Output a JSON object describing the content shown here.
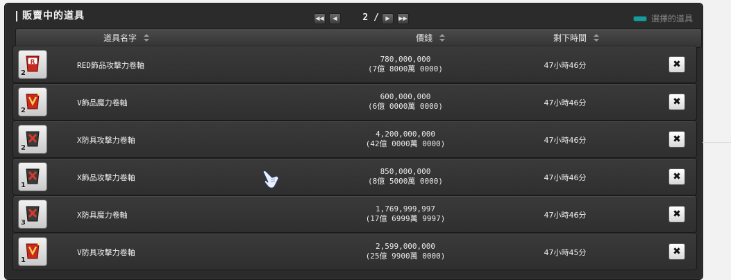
{
  "panel": {
    "title": "販賣中的道具"
  },
  "pager": {
    "first": "◀◀",
    "prev": "◀",
    "page": "2 / 5",
    "next": "▶",
    "last": "▶▶"
  },
  "legend": {
    "label": "選擇的道具",
    "swatch_color": "#1a9a9a"
  },
  "columns": {
    "name": "道具名字",
    "price": "價錢",
    "time": "剩下時間"
  },
  "delete_glyph": "✖",
  "rows": [
    {
      "icon": "red-scroll-r-icon",
      "qty": "2",
      "name": "RED飾品攻擊力卷軸",
      "price": "780,000,000",
      "price_detail": "(7億 8000萬 0000)",
      "time": "47小時46分"
    },
    {
      "icon": "v-scroll-red-icon",
      "qty": "2",
      "name": "V飾品魔力卷軸",
      "price": "600,000,000",
      "price_detail": "(6億 0000萬 0000)",
      "time": "47小時46分"
    },
    {
      "icon": "x-scroll-dark-icon",
      "qty": "2",
      "name": "X防具攻擊力卷軸",
      "price": "4,200,000,000",
      "price_detail": "(42億 0000萬 0000)",
      "time": "47小時46分"
    },
    {
      "icon": "x-scroll-dark-icon",
      "qty": "1",
      "name": "X飾品攻擊力卷軸",
      "price": "850,000,000",
      "price_detail": "(8億 5000萬 0000)",
      "time": "47小時46分"
    },
    {
      "icon": "x-scroll-dark-icon",
      "qty": "3",
      "name": "X防具魔力卷軸",
      "price": "1,769,999,997",
      "price_detail": "(17億 6999萬 9997)",
      "time": "47小時46分"
    },
    {
      "icon": "v-scroll-red-icon",
      "qty": "1",
      "name": "V防具攻擊力卷軸",
      "price": "2,599,000,000",
      "price_detail": "(25億 9900萬 0000)",
      "time": "47小時45分"
    }
  ]
}
